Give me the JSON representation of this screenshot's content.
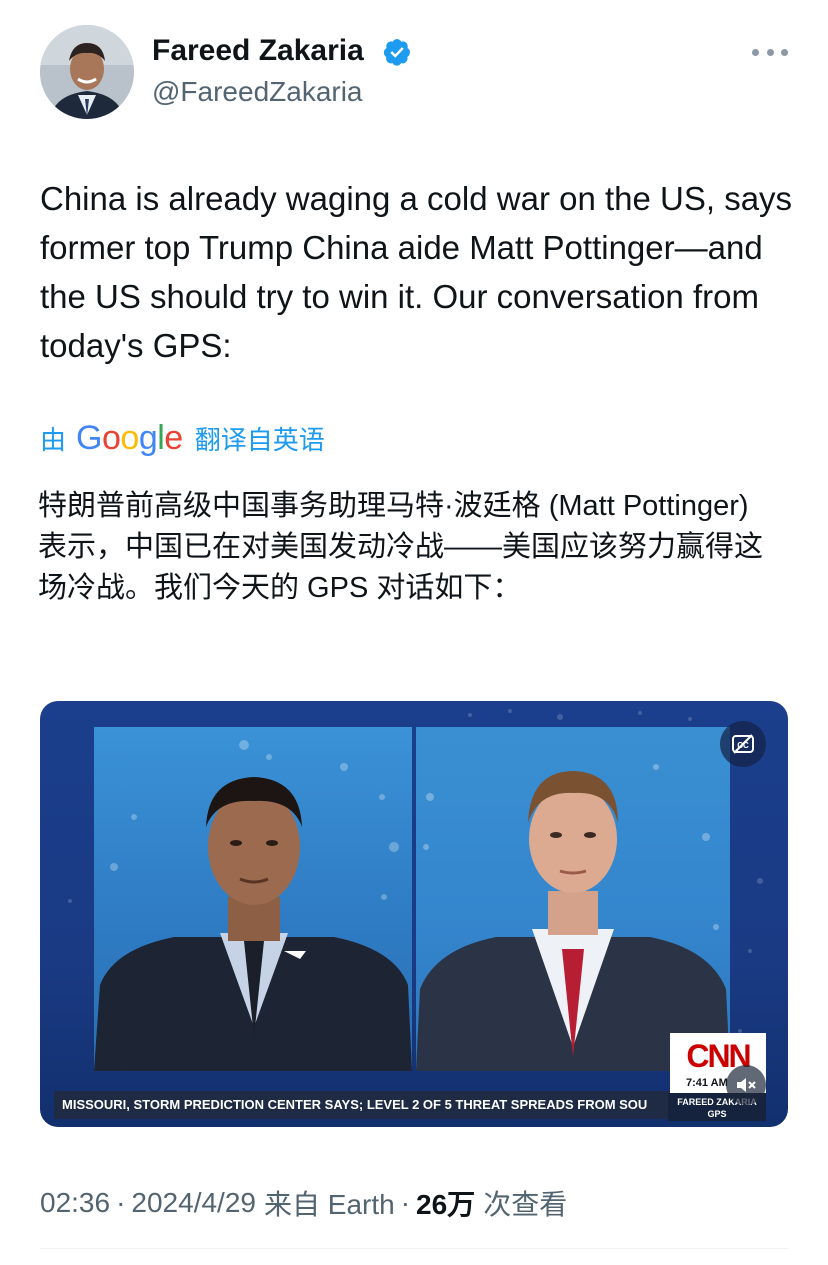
{
  "author": {
    "display_name": "Fareed Zakaria",
    "handle": "@FareedZakaria",
    "verified": true
  },
  "tweet": {
    "text": "China is already waging a cold war on the US, says former top Trump China aide Matt Pottinger—and the US should try to win it. Our conversation from today's GPS:"
  },
  "translation": {
    "prefix": "由",
    "provider": "Google",
    "suffix": "翻译自英语",
    "text": "特朗普前高级中国事务助理马特·波廷格 (Matt Pottinger) 表示，中国已在对美国发动冷战——美国应该努力赢得这场冷战。我们今天的 GPS 对话如下："
  },
  "video": {
    "ticker": "MISSOURI, STORM PREDICTION CENTER SAYS; LEVEL 2 OF 5 THREAT SPREADS FROM SOU",
    "network": "CNN",
    "clock": "7:41 AM",
    "show_line1": "FAREED ZAKARIA",
    "show_line2": "GPS",
    "cc_icon": "closed-captions-off-icon",
    "mute_icon": "speaker-muted-icon"
  },
  "meta": {
    "time": "02:36",
    "date": "2024/4/29",
    "source": "来自 Earth",
    "views_count": "26万",
    "views_label": "次查看"
  },
  "colors": {
    "accent": "#1d9bf0",
    "text_primary": "#0f1419",
    "text_secondary": "#536471",
    "cnn_red": "#cc0000"
  }
}
